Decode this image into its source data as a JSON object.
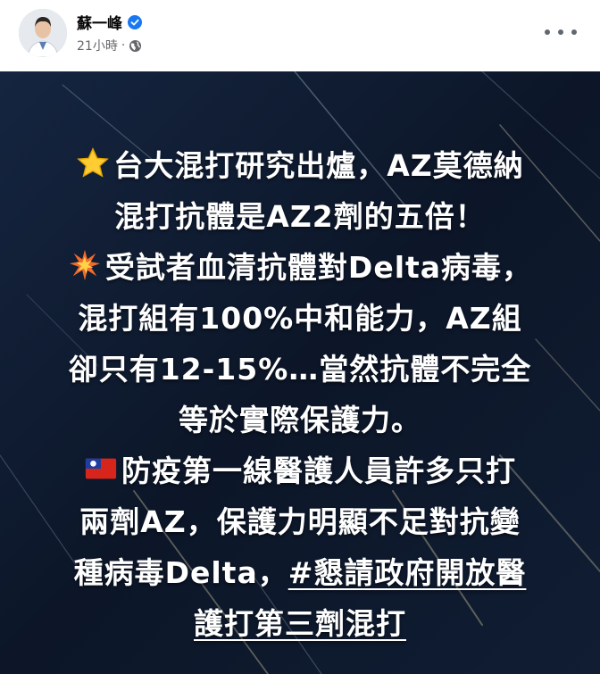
{
  "author": {
    "name": "蘇一峰",
    "verified_icon": "verified-badge-icon",
    "time": "21小時",
    "separator": "·",
    "privacy_icon": "globe-icon"
  },
  "menu_icon": "more-options-icon",
  "post": {
    "background_color": "#0f1a2e",
    "lines": [
      "台大混打研究出爐，AZ莫德納",
      "混打抗體是AZ2劑的五倍！",
      "受試者血清抗體對Delta病毒，",
      "混打組有100%中和能力，AZ組",
      "卻只有12-15%…當然抗體不完全",
      "等於實際保護力。",
      "防疫第一線醫護人員許多只打",
      "兩劑AZ，保護力明顯不足對抗變",
      "種病毒Delta，",
      "#懇請政府開放醫",
      "護打第三劑混打"
    ],
    "emojis": [
      "star-emoji-icon",
      "collision-emoji-icon",
      "taiwan-flag-emoji-icon"
    ]
  }
}
